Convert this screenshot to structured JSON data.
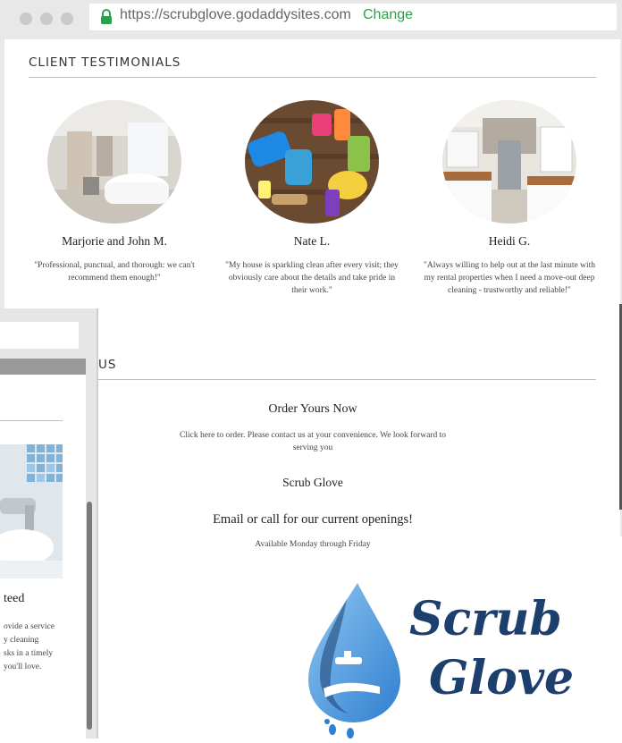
{
  "browser": {
    "url": "https://scrubglove.godaddysites.com",
    "change_label": "Change"
  },
  "testimonials": {
    "title": "CLIENT TESTIMONIALS",
    "items": [
      {
        "name": "Marjorie and John M.",
        "quote": "\"Professional, punctual, and thorough: we can't recommend them enough!\"",
        "image": "bathroom-photo"
      },
      {
        "name": "Nate L.",
        "quote": "\"My house is sparkling clean after every visit; they obviously care about the details and take pride in their work.\"",
        "image": "cleaning-supplies-photo"
      },
      {
        "name": "Heidi G.",
        "quote": "\"Always willing to help out at the last minute with my rental properties when I need a move-out deep cleaning - trustworthy and reliable!\"",
        "image": "kitchen-photo"
      }
    ]
  },
  "contact": {
    "title_partial": "US",
    "order_heading": "Order Yours Now",
    "order_text": "Click here to order. Please contact us at your convenience.  We look forward to serving you",
    "company": "Scrub Glove",
    "openings": "Email or call for our current openings!",
    "availability": "Available Monday through Friday"
  },
  "second_window": {
    "heading_partial": "teed",
    "text_lines": [
      "ovide a service",
      "y cleaning",
      "sks in a timely",
      " you'll love."
    ]
  },
  "logo": {
    "line1": "Scrub",
    "line2": "Glove"
  },
  "colors": {
    "accent_green": "#2aa14a",
    "logo_blue": "#1c3f6e",
    "drop_blue": "#5aa7e6"
  }
}
